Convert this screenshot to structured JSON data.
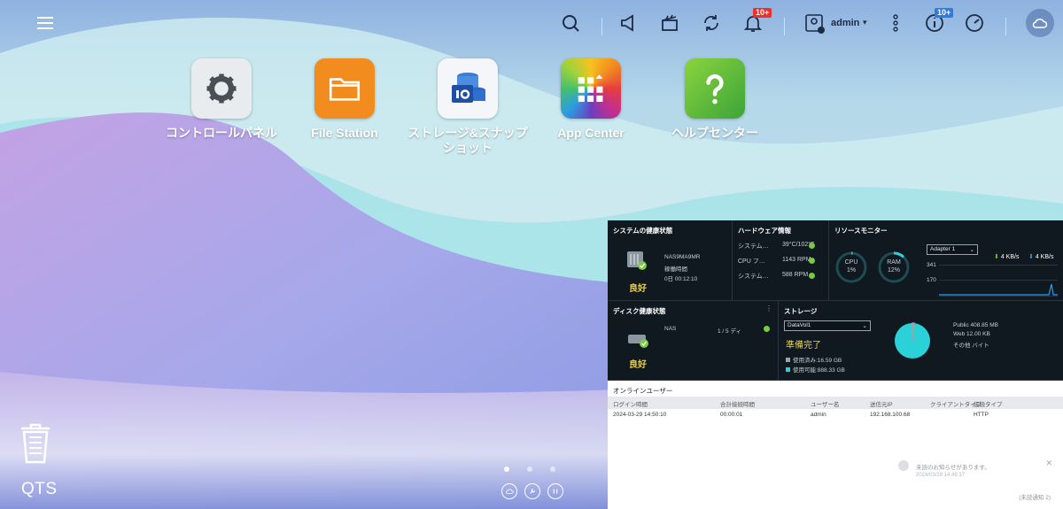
{
  "topbar": {
    "menu_icon": "hamburger-icon",
    "icons": [
      "search-icon",
      "megaphone-icon",
      "clapper-icon",
      "sync-icon",
      "bell-icon",
      "user-icon",
      "kebab-icon",
      "info-icon",
      "gauge-icon",
      "cloud-icon"
    ],
    "notifications_badge": "10+",
    "info_badge": "10+",
    "user_name": "admin",
    "user_caret": "▾"
  },
  "apps": [
    {
      "label": "コントロールパネル",
      "icon": "gear-icon"
    },
    {
      "label": "File Station",
      "icon": "folder-icon"
    },
    {
      "label": "ストレージ&スナップショット",
      "icon": "storage-icon"
    },
    {
      "label": "App Center",
      "icon": "app-grid-icon"
    },
    {
      "label": "ヘルプセンター",
      "icon": "question-icon"
    }
  ],
  "desktop": {
    "logo": "QTS",
    "page_dots": 3,
    "active_page": 1
  },
  "dashboard": {
    "system": {
      "title": "システムの健康状態",
      "model": "NAS9MA9MR",
      "uptime_label": "稼働時間",
      "uptime": "0日 00:12:10",
      "status": "良好"
    },
    "hardware": {
      "title": "ハードウェア情報",
      "rows": [
        {
          "label": "システム…",
          "value": "39°C/102°F"
        },
        {
          "label": "CPU フ…",
          "value": "1143 RPM"
        },
        {
          "label": "システム…",
          "value": "588 RPM"
        }
      ]
    },
    "resources": {
      "title": "リソースモニター",
      "cpu_label": "CPU",
      "cpu": "1%",
      "cpu_fraction": 0.01,
      "ram_label": "RAM",
      "ram": "12%",
      "ram_fraction": 0.12,
      "adapter": "Adapter 1",
      "upload": "4 KB/s",
      "download": "4 KB/s",
      "y_top": "341",
      "y_mid": "170"
    },
    "disk": {
      "title": "ディスク健康状態",
      "name": "NAS",
      "count": "1 / 5 ディ",
      "status": "良好"
    },
    "storage": {
      "title": "ストレージ",
      "volume": "DataVol1",
      "status": "準備完了",
      "used": "使用済み:16.59 GB",
      "free": "使用可能:888.33 GB",
      "used_color": "#9aa4ae",
      "free_color": "#2ad1d8",
      "used_fraction": 0.018,
      "shares": [
        "Public  408.85 MB",
        "Web  12.00 KB",
        "その他  バイト"
      ]
    },
    "online_users": {
      "title": "オンラインユーザー",
      "headers": [
        "ログイン時間",
        "合計接続時間",
        "ユーザー名",
        "送信元IP",
        "クライアントタイプ",
        "接続タイプ"
      ],
      "rows": [
        [
          "2024-03-29 14:50:10",
          "00:00:01",
          "admin",
          "192.168.100.68",
          "",
          "HTTP"
        ]
      ]
    },
    "toast": {
      "line1": "未読のお知らせがあります。",
      "line2": "2024/03/29 14:49:37",
      "count": "(未読通知 2)"
    }
  }
}
